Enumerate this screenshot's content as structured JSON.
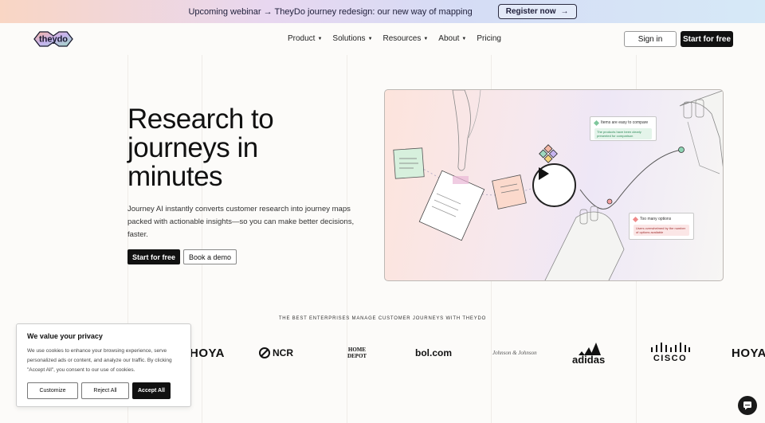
{
  "banner": {
    "message": "Upcoming webinar → TheyDo journey redesign: our new way of mapping",
    "register_label": "Register now"
  },
  "nav": {
    "logo_text": "theydo",
    "menu": [
      {
        "label": "Product",
        "has_dropdown": true
      },
      {
        "label": "Solutions",
        "has_dropdown": true
      },
      {
        "label": "Resources",
        "has_dropdown": true
      },
      {
        "label": "About",
        "has_dropdown": true
      },
      {
        "label": "Pricing",
        "has_dropdown": false
      }
    ],
    "sign_in": "Sign in",
    "start_free": "Start for free"
  },
  "hero": {
    "title_lines": [
      "Research to",
      "journeys in",
      "minutes"
    ],
    "description": "Journey AI instantly converts customer research into journey maps packed with actionable insights—so you can make better decisions, faster.",
    "primary_cta": "Start for free",
    "secondary_cta": "Book a demo"
  },
  "video": {
    "card_positive": {
      "title": "Items are easy to compare",
      "detail": "The products have been clearly presented for comparison"
    },
    "card_negative": {
      "title": "Too many options",
      "detail": "Users overwhelmed by the number of options available"
    }
  },
  "enterprises": {
    "heading": "THE BEST ENTERPRISES MANAGE CUSTOMER JOURNEYS WITH THEYDO",
    "logos": [
      "HOYA",
      "NCR",
      "HOME DEPOT",
      "bol.com",
      "Johnson & Johnson",
      "adidas",
      "CISCO",
      "HOYA"
    ]
  },
  "cookie": {
    "title": "We value your privacy",
    "body": "We use cookies to enhance your browsing experience, serve personalized ads or content, and analyze our traffic. By clicking \"Accept All\", you consent to our use of cookies.",
    "customize": "Customize",
    "reject": "Reject All",
    "accept": "Accept All"
  },
  "colors": {
    "brand_dark": "#111111",
    "accent_green": "#7fc79c",
    "accent_red": "#ef8a8a"
  }
}
